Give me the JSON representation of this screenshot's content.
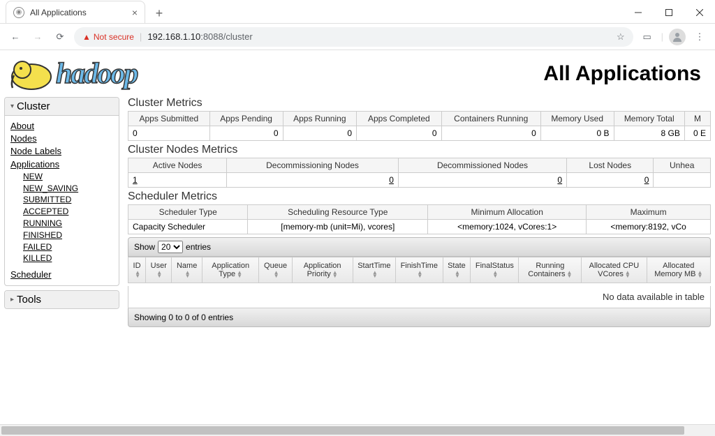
{
  "browser": {
    "tab_title": "All Applications",
    "not_secure": "Not secure",
    "url_host": "192.168.1.10",
    "url_port": ":8088",
    "url_path": "/cluster"
  },
  "header": {
    "logo_text": "hadoop",
    "page_title": "All Applications"
  },
  "sidebar": {
    "cluster": "Cluster",
    "tools": "Tools",
    "links": {
      "about": "About",
      "nodes": "Nodes",
      "node_labels": "Node Labels",
      "applications": "Applications",
      "scheduler": "Scheduler"
    },
    "states": {
      "new": "NEW",
      "new_saving": "NEW_SAVING",
      "submitted": "SUBMITTED",
      "accepted": "ACCEPTED",
      "running": "RUNNING",
      "finished": "FINISHED",
      "failed": "FAILED",
      "killed": "KILLED"
    }
  },
  "cluster_metrics": {
    "title": "Cluster Metrics",
    "h": {
      "submitted": "Apps Submitted",
      "pending": "Apps Pending",
      "running": "Apps Running",
      "completed": "Apps Completed",
      "containers": "Containers Running",
      "mem_used": "Memory Used",
      "mem_total": "Memory Total",
      "m": "M"
    },
    "v": {
      "submitted": "0",
      "pending": "0",
      "running": "0",
      "completed": "0",
      "containers": "0",
      "mem_used": "0 B",
      "mem_total": "8 GB",
      "m": "0 E"
    }
  },
  "nodes_metrics": {
    "title": "Cluster Nodes Metrics",
    "h": {
      "active": "Active Nodes",
      "decommissioning": "Decommissioning Nodes",
      "decommissioned": "Decommissioned Nodes",
      "lost": "Lost Nodes",
      "unhealthy": "Unhea"
    },
    "v": {
      "active": "1",
      "decommissioning": "0",
      "decommissioned": "0",
      "lost": "0"
    }
  },
  "scheduler_metrics": {
    "title": "Scheduler Metrics",
    "h": {
      "type": "Scheduler Type",
      "resource": "Scheduling Resource Type",
      "min": "Minimum Allocation",
      "max": "Maximum"
    },
    "v": {
      "type": "Capacity Scheduler",
      "resource": "[memory-mb (unit=Mi), vcores]",
      "min": "<memory:1024, vCores:1>",
      "max": "<memory:8192, vCo"
    }
  },
  "apps_table": {
    "show": "Show",
    "entries": "entries",
    "page_size": "20",
    "cols": {
      "id": "ID",
      "user": "User",
      "name": "Name",
      "apptype": "Application Type",
      "queue": "Queue",
      "priority": "Application Priority",
      "start": "StartTime",
      "finish": "FinishTime",
      "state": "State",
      "finalstatus": "FinalStatus",
      "containers": "Running Containers",
      "vcores": "Allocated CPU VCores",
      "mem": "Allocated Memory MB"
    },
    "nodata": "No data available in table",
    "info": "Showing 0 to 0 of 0 entries"
  }
}
